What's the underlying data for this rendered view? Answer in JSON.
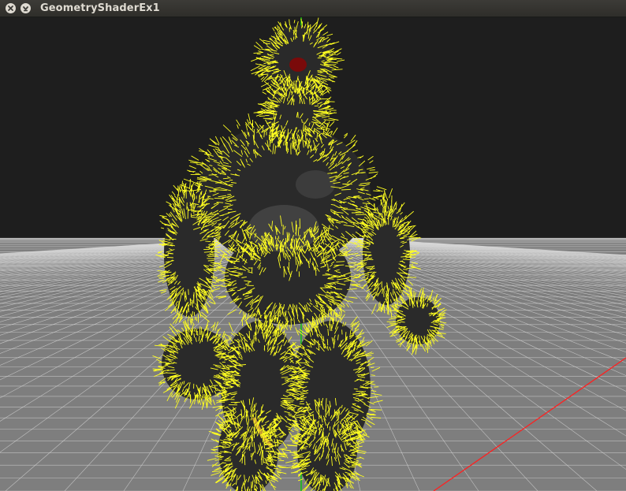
{
  "window": {
    "title": "GeometryShaderEx1"
  },
  "titlebar": {
    "close_icon": "close-icon",
    "minimize_icon": "minimize-icon"
  },
  "scene": {
    "background_color": "#1e1e1e",
    "floor_color": "#7e7e7e",
    "grid_line_color": "#d8d8d8",
    "x_axis_color": "#ff2020",
    "y_axis_color": "#10c010",
    "model_body_color": "#2a2a2a",
    "normal_line_color": "#ffff20",
    "visualization": "vertex normals rendered as yellow lines by geometry shader"
  }
}
